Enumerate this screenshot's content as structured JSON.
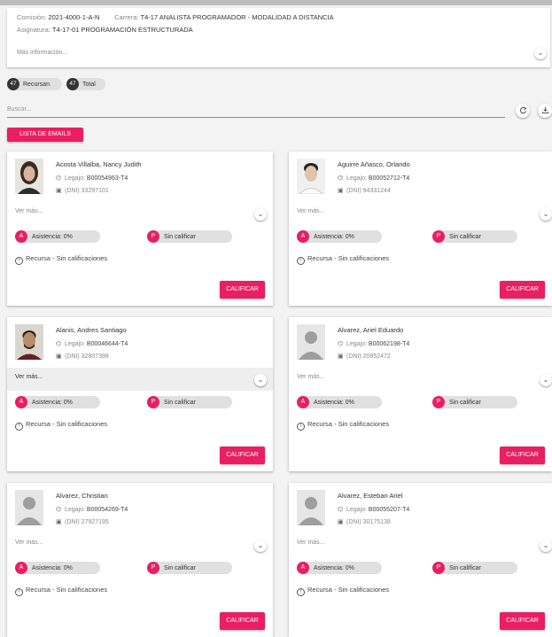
{
  "header": {
    "comision_label": "Comisión:",
    "comision_value": "2021-4000-1-A-N",
    "carrera_label": "Carrera:",
    "carrera_value": "T4-17 ANALISTA PROGRAMADOR - MODALIDAD A DISTANCIA",
    "asignatura_label": "Asignatura:",
    "asignatura_value": "T4-17-01 PROGRAMACIÓN ESTRUCTURADA",
    "more_info": "Más información...",
    "chevron": "⌄"
  },
  "counts": {
    "recursan_count": "47",
    "recursan_label": "Recursan",
    "total_count": "47",
    "total_label": "Total"
  },
  "search": {
    "placeholder": "Buscar..."
  },
  "toolbar": {
    "refresh_icon": "refresh-icon",
    "download_icon": "download-icon"
  },
  "email_button": "LISTA DE EMAILS",
  "students": [
    {
      "name": "Acosta Villalba, Nancy Judith",
      "legajo_label": "Legajo:",
      "legajo": "B00054963-T4",
      "dni": "(DNI) 33297101",
      "ver_mas": "Ver más...",
      "asistencia": "Asistencia: 0%",
      "calificacion": "Sin calificar",
      "status": "Recursa - Sin calificaciones",
      "action": "CALIFICAR",
      "photo": "female"
    },
    {
      "name": "Aguirre Añasco, Orlando",
      "legajo_label": "Legajo:",
      "legajo": "B00052712-T4",
      "dni": "(DNI) 94331244",
      "ver_mas": "Ver más...",
      "asistencia": "Asistencia: 0%",
      "calificacion": "Sin calificar",
      "status": "Recursa - Sin calificaciones",
      "action": "CALIFICAR",
      "photo": "male-light"
    },
    {
      "name": "Alanis, Andres Santiago",
      "legajo_label": "Legajo:",
      "legajo": "B00046644-T4",
      "dni": "(DNI) 32807398",
      "ver_mas": "Ver más...",
      "asistencia": "Asistencia: 0%",
      "calificacion": "Sin calificar",
      "status": "Recursa - Sin calificaciones",
      "action": "CALIFICAR",
      "photo": "male-beard"
    },
    {
      "name": "Alvarez, Ariel Eduardo",
      "legajo_label": "Legajo:",
      "legajo": "B00062198-T4",
      "dni": "(DNI) 20852472",
      "ver_mas": "Ver más...",
      "asistencia": "Asistencia: 0%",
      "calificacion": "Sin calificar",
      "status": "Recursa - Sin calificaciones",
      "action": "CALIFICAR",
      "photo": "placeholder"
    },
    {
      "name": "Alvarez, Christian",
      "legajo_label": "Legajo:",
      "legajo": "B00054269-T4",
      "dni": "(DNI) 27927195",
      "ver_mas": "Ver más...",
      "asistencia": "Asistencia: 0%",
      "calificacion": "Sin calificar",
      "status": "Recursa - Sin calificaciones",
      "action": "CALIFICAR",
      "photo": "placeholder"
    },
    {
      "name": "Alvarez, Esteban Ariel",
      "legajo_label": "Legajo:",
      "legajo": "B00055207-T4",
      "dni": "(DNI) 30175138",
      "ver_mas": "Ver más...",
      "asistencia": "Asistencia: 0%",
      "calificacion": "Sin calificar",
      "status": "Recursa - Sin calificaciones",
      "action": "CALIFICAR",
      "photo": "placeholder"
    }
  ],
  "badges": {
    "asistencia_letter": "A",
    "calificacion_letter": "P",
    "status_symbol": "!"
  },
  "colors": {
    "accent": "#e91e63",
    "chip_bg": "#e0e0e0",
    "count_bg": "#333333"
  }
}
